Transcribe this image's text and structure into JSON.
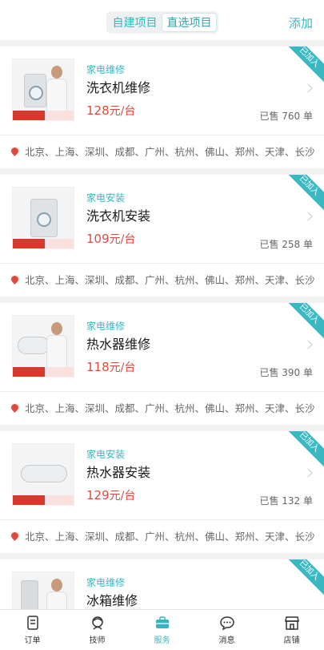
{
  "header": {
    "segments": [
      "自建项目",
      "直选项目"
    ],
    "active_segment": 1,
    "add_label": "添加"
  },
  "added_badge": "已加入",
  "cities_text": "北京、上海、深圳、成都、广州、杭州、佛山、郑州、天津、长沙、",
  "price_unit": "元/台",
  "items": [
    {
      "category": "家电维修",
      "title": "洗衣机维修",
      "price": "128",
      "sold": "已售 760 单",
      "thumb_kind": "washer-repair"
    },
    {
      "category": "家电安装",
      "title": "洗衣机安装",
      "price": "109",
      "sold": "已售 258 单",
      "thumb_kind": "washer"
    },
    {
      "category": "家电维修",
      "title": "热水器维修",
      "price": "118",
      "sold": "已售 390 单",
      "thumb_kind": "heater-repair"
    },
    {
      "category": "家电安装",
      "title": "热水器安装",
      "price": "129",
      "sold": "已售 132 单",
      "thumb_kind": "heater"
    },
    {
      "category": "家电维修",
      "title": "冰箱维修",
      "price": "",
      "sold": "",
      "thumb_kind": "fridge-repair"
    }
  ],
  "tabs": [
    {
      "label": "订单",
      "icon": "order-icon"
    },
    {
      "label": "技师",
      "icon": "technician-icon"
    },
    {
      "label": "服务",
      "icon": "service-toolbox-icon"
    },
    {
      "label": "消息",
      "icon": "message-icon"
    },
    {
      "label": "店铺",
      "icon": "store-icon"
    }
  ],
  "active_tab": 2,
  "colors": {
    "accent": "#36b5c0",
    "price": "#e04a3a",
    "badge": "#3ab8c4"
  }
}
